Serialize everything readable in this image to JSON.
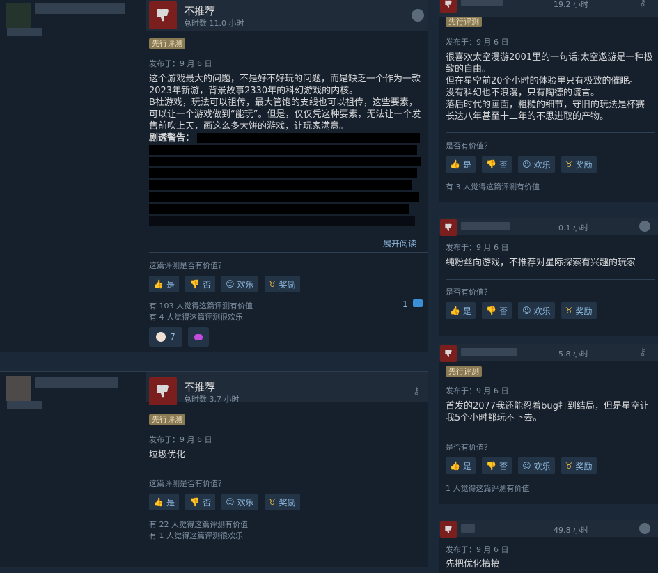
{
  "colors": {
    "bg": "#1b2838",
    "card": "#16202d",
    "accent": "#8fb8dd",
    "thumbs_down": "#7a1e1e",
    "early_badge": "#8a7a53"
  },
  "icons": {
    "thumbs_down": "thumbs-down-icon",
    "steam": "steam-icon",
    "award": "award-icon",
    "comment": "comment-icon",
    "key": "key-icon"
  },
  "common": {
    "early_access": "先行评测",
    "helpful_question_main": "这篇评测是否有价值？",
    "helpful_question_side": "是否有价值？",
    "yes": "是",
    "no": "否",
    "funny": "欢乐",
    "award": "奖励",
    "not_recommended": "不推荐",
    "read_more": "展开阅读",
    "spoiler_label": "剧透警告："
  },
  "main": [
    {
      "hours": "总时数 11.0 小时",
      "posted": "发布于：9 月 6 日",
      "text": "这个游戏最大的问题，不是好不好玩的问题，而是缺乏一个作为一款2023年新游，背景故事2330年的科幻游戏的内核。\nB社游戏，玩法可以祖传，最大管饱的支线也可以祖传，这些要素，可以让一个游戏做到“能玩”。但是，仅仅凭这种要素，无法让一个发售前吹上天，画这么多大饼的游戏，让玩家满意。",
      "helpful": "有 103 人觉得这篇评测有价值",
      "funny": "有 4 人觉得这篇评测很欢乐",
      "comments": "1",
      "award_count": "7"
    },
    {
      "hours": "总时数 3.7 小时",
      "posted": "发布于：9 月 6 日",
      "text": "垃圾优化",
      "helpful": "有 22 人觉得这篇评测有价值",
      "funny": "有 1 人觉得这篇评测很欢乐"
    }
  ],
  "side": [
    {
      "hours": "19.2 小时",
      "posted": "发布于：9 月 6 日",
      "text": "很喜欢太空漫游2001里的一句话:太空遨游是一种极致的自由。\n但在星空前20个小时的体验里只有极致的催眠。\n没有科幻也不浪漫，只有陶德的谎言。\n落后时代的画面，粗糙的细节，守旧的玩法是杯赛长达八年甚至十二年的不思进取的产物。",
      "stat": "有 3 人觉得这篇评测有价值"
    },
    {
      "hours": "0.1 小时",
      "posted": "发布于：9 月 6 日",
      "text": "纯粉丝向游戏，不推荐对星际探索有兴趣的玩家"
    },
    {
      "hours": "5.8 小时",
      "posted": "发布于：9 月 6 日",
      "text": "首发的2077我还能忍着bug打到结局，但是星空让我5个小时都玩不下去。",
      "stat": "1 人觉得这篇评测有价值"
    },
    {
      "hours": "49.8 小时",
      "posted": "发布于：9 月 6 日",
      "text": "先把优化搞搞"
    }
  ]
}
